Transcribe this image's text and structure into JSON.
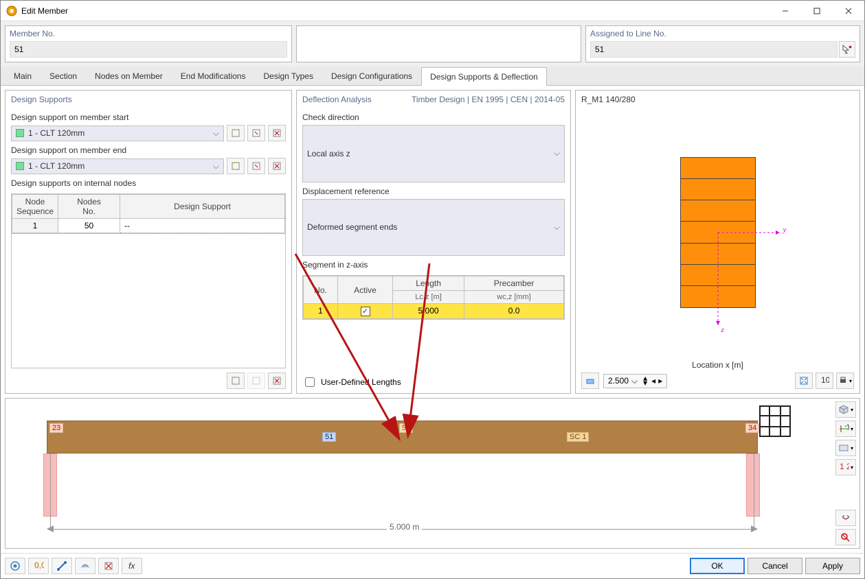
{
  "window": {
    "title": "Edit Member"
  },
  "header": {
    "member_no_label": "Member No.",
    "member_no_value": "51",
    "assigned_label": "Assigned to Line No.",
    "assigned_value": "51"
  },
  "tabs": [
    "Main",
    "Section",
    "Nodes on Member",
    "End Modifications",
    "Design Types",
    "Design Configurations",
    "Design Supports & Deflection"
  ],
  "active_tab_index": 6,
  "design_supports": {
    "title": "Design Supports",
    "start_label": "Design support on member start",
    "start_value": "1 - CLT  120mm",
    "end_label": "Design support on member end",
    "end_value": "1 - CLT  120mm",
    "internal_label": "Design supports on internal nodes",
    "grid_headers": {
      "seq": "Node\nSequence",
      "nodes": "Nodes\nNo.",
      "support": "Design Support"
    },
    "rows": [
      {
        "seq": "1",
        "nodes": "50",
        "support": "--"
      }
    ]
  },
  "deflection": {
    "title": "Deflection Analysis",
    "norm": "Timber Design | EN 1995 | CEN | 2014-05",
    "check_dir_label": "Check direction",
    "check_dir_value": "Local axis z",
    "disp_ref_label": "Displacement reference",
    "disp_ref_value": "Deformed segment ends",
    "segment_label": "Segment in z-axis",
    "seg_headers": {
      "no": "No.",
      "active": "Active",
      "length": "Length",
      "length_sub": "Lc,z [m]",
      "precamber": "Precamber",
      "precamber_sub": "wc,z [mm]"
    },
    "seg_rows": [
      {
        "no": "1",
        "active": true,
        "length": "5.000",
        "precamber": "0.0"
      }
    ],
    "user_defined": "User-Defined Lengths"
  },
  "section_preview": {
    "name": "R_M1 140/280",
    "location_label": "Location x [m]",
    "location_value": "2.500",
    "axes": {
      "y": "y",
      "z": "z"
    }
  },
  "beam_preview": {
    "node_left": "23",
    "node_right": "34",
    "node_internal": "50",
    "member_id": "51",
    "sc": "SC 1",
    "dim": "5.000 m"
  },
  "buttons": {
    "ok": "OK",
    "cancel": "Cancel",
    "apply": "Apply"
  }
}
